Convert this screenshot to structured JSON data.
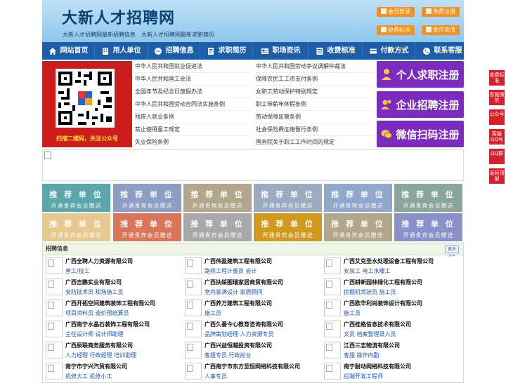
{
  "header": {
    "title": "大新人才招聘网",
    "subtitle": "大新人才招聘网最新招聘信息　大新人才招聘网最新求职简历",
    "buttons": [
      "会员登录",
      "免费注册",
      "收费标准",
      "金币充值"
    ]
  },
  "nav": [
    "网站首页",
    "用人单位",
    "招聘信息",
    "求职简历",
    "职场资讯",
    "收费标准",
    "付款方式",
    "联系客服"
  ],
  "qr": {
    "caption": "扫描二维码，关注公众号"
  },
  "links": [
    [
      "中华人民共和国就业促进法",
      "中华人民共和国劳动争议调解仲裁法"
    ],
    [
      "中华人民共和国工会法",
      "保障农民工工资支付条例"
    ],
    [
      "全国年节及纪念日放假办法",
      "女职工劳动保护特别规定"
    ],
    [
      "中华人民共和国劳动合同法实施条例",
      "职工带薪年休假条例"
    ],
    [
      "残疾人就业条例",
      "劳动保障监察条例"
    ],
    [
      "禁止使用童工规定",
      "社会保险费征缴暂行条例"
    ],
    [
      "失业保险条例",
      "国务院关于职工工作时间的规定"
    ]
  ],
  "register": [
    "个人求职注册",
    "企业招聘注册",
    "微信扫码注册"
  ],
  "recommend": {
    "title": "推 荐 单 位",
    "sub": "开通贵宾会员赠送",
    "colors": [
      "#5aa6a8",
      "#8c9ec4",
      "#b2a68c",
      "#9aaac0",
      "#8fa8cc",
      "#8aa69c",
      "#e6c98e",
      "#d9765a",
      "#a8a8a8",
      "#cf9a1e",
      "#b2a68c",
      "#8a90c8"
    ]
  },
  "jobs": {
    "title": "招聘信息",
    "more": "更多>>",
    "companies": [
      {
        "name": "广西全聘人力资源有限公司",
        "jobs": "普工/技工"
      },
      {
        "name": "广西伟盈建筑工程有限公司",
        "jobs": "路桥工程计量员 会计"
      },
      {
        "name": "广西艾克圣水处理设备工程有限公司",
        "jobs": "安装工 电工水暖工"
      },
      {
        "name": "广西吉鹏实业有限公司",
        "jobs": "安防技术员 现场施工员"
      },
      {
        "name": "广西扶绥图瑞家居商贸有限公司",
        "jobs": "室内装满设计 家居顾问"
      },
      {
        "name": "广西耕新园林绿化工程有限公司",
        "jobs": "挖掘机驾驶员 施工员"
      },
      {
        "name": "广西开拓空间建筑装饰工程有限公司",
        "jobs": "项目资料员 造价预结算员"
      },
      {
        "name": "广西养万建筑工程有限公司",
        "jobs": "施工员"
      },
      {
        "name": "广西欧华利尚装饰设计有限公司",
        "jobs": "施工员"
      },
      {
        "name": "广西南宁水晶石装饰工程有限公司",
        "jobs": "主任设计师 设计师助理"
      },
      {
        "name": "广西久番今心教育咨询有限公司",
        "jobs": "品牌策划经理 人力资源专员"
      },
      {
        "name": "广西桂格信息技术有限公司",
        "jobs": "文员 档案整理录入员"
      },
      {
        "name": "广西辰联商务服务有限公司",
        "jobs": "人力经理 行政经理 培训助理"
      },
      {
        "name": "广西兴益恒越投资有限公司",
        "jobs": "客服专员 行政前台"
      },
      {
        "name": "江西三志物流有限公司",
        "jobs": "客服 操作内勤"
      },
      {
        "name": "南宁市宁兴汽贸有限公司",
        "jobs": "机修大工 机修小工"
      },
      {
        "name": "广西南宁市东方至恒网络科技有限公司",
        "jobs": "人事专员"
      },
      {
        "name": "南宁耐动网络科技有限公司",
        "jobs": "后端开发工程师"
      }
    ]
  },
  "float_bar": [
    "收费标准",
    "客服微信",
    "公众号",
    "客服QQ号",
    "QQ群",
    "返回顶部"
  ],
  "colors": {
    "nav": "#1e5ea8",
    "accent": "#f29220",
    "register": "#7b2cbf",
    "qr_bg": "#cc1d1d",
    "float": "#d8202a"
  }
}
